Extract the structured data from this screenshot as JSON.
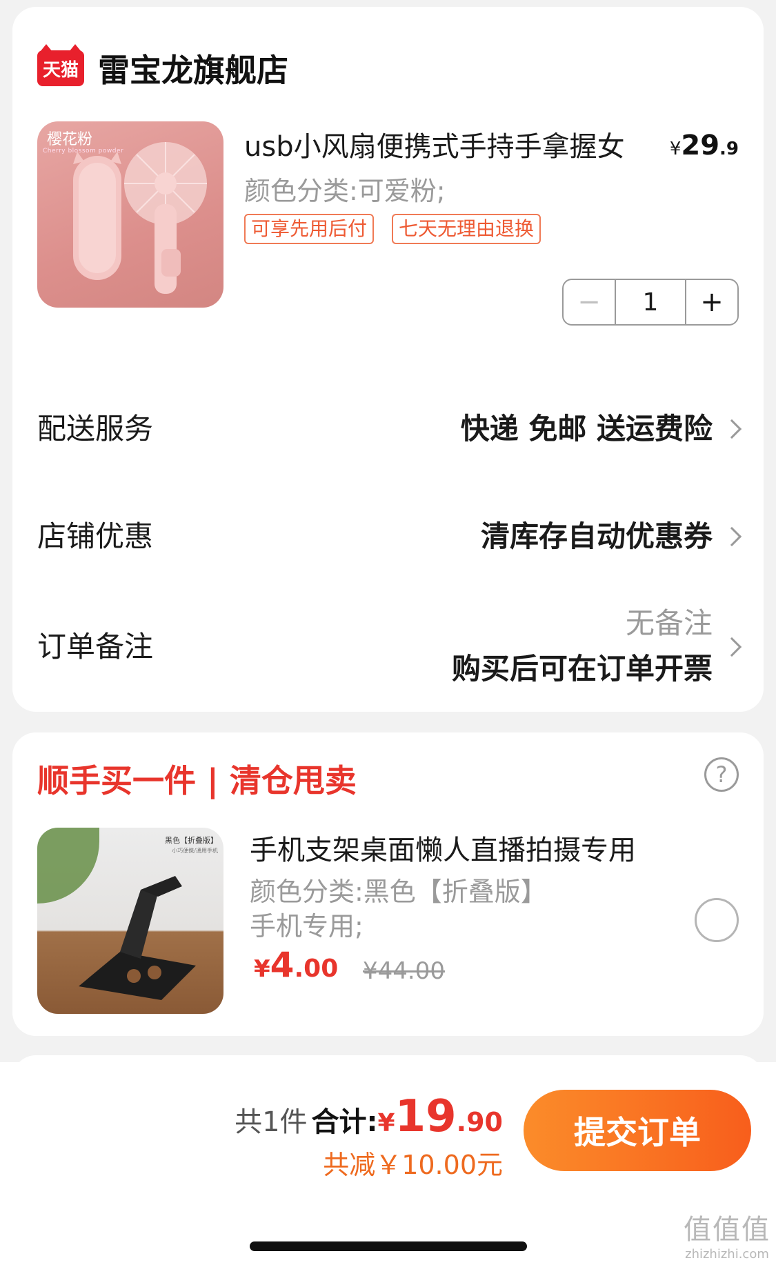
{
  "shop": {
    "badge": "天猫",
    "name": "雷宝龙旗舰店"
  },
  "item": {
    "thumb_label": "樱花粉",
    "thumb_sublabel": "Cherry blossom powder",
    "title": "usb小风扇便携式手持手拿握女",
    "spec": "颜色分类:可爱粉;",
    "price_currency": "¥",
    "price_int": "29",
    "price_dec": ".9",
    "tags": [
      "可享先用后付",
      "七天无理由退换"
    ],
    "quantity": "1",
    "minus": "−",
    "plus": "+"
  },
  "rows": {
    "delivery_label": "配送服务",
    "delivery_value": "快递 免邮 送运费险",
    "coupon_label": "店铺优惠",
    "coupon_value": "清库存自动优惠券",
    "note_label": "订单备注",
    "note_value": "无备注",
    "note_sub": "购买后可在订单开票"
  },
  "addon": {
    "title": "顺手买一件 | 清仓甩卖",
    "help": "?",
    "thumb_label": "黑色【折叠版】",
    "thumb_sub": "小巧便携/通用手机",
    "title_text": "手机支架桌面懒人直播拍摄专用",
    "spec_line1": "颜色分类:黑色【折叠版】",
    "spec_line2": "手机专用;",
    "price_currency": "¥",
    "price_int": "4",
    "price_dec": ".00",
    "orig_price": "¥44.00"
  },
  "footer": {
    "count": "共1件",
    "total_label": "合计:",
    "currency": "¥",
    "total_int": "19",
    "total_dec": ".90",
    "saved": "共减￥10.00元",
    "submit": "提交订单"
  },
  "watermark": {
    "big": "值值值",
    "small": "zhizhizhi.com"
  },
  "colors": {
    "accent_red": "#e8352c",
    "tmall_red": "#e8202c",
    "submit_gradient_start": "#fb8c2a",
    "submit_gradient_end": "#f85e1c",
    "tag_orange": "#ee5a33",
    "muted_gray": "#9a9a9a"
  }
}
